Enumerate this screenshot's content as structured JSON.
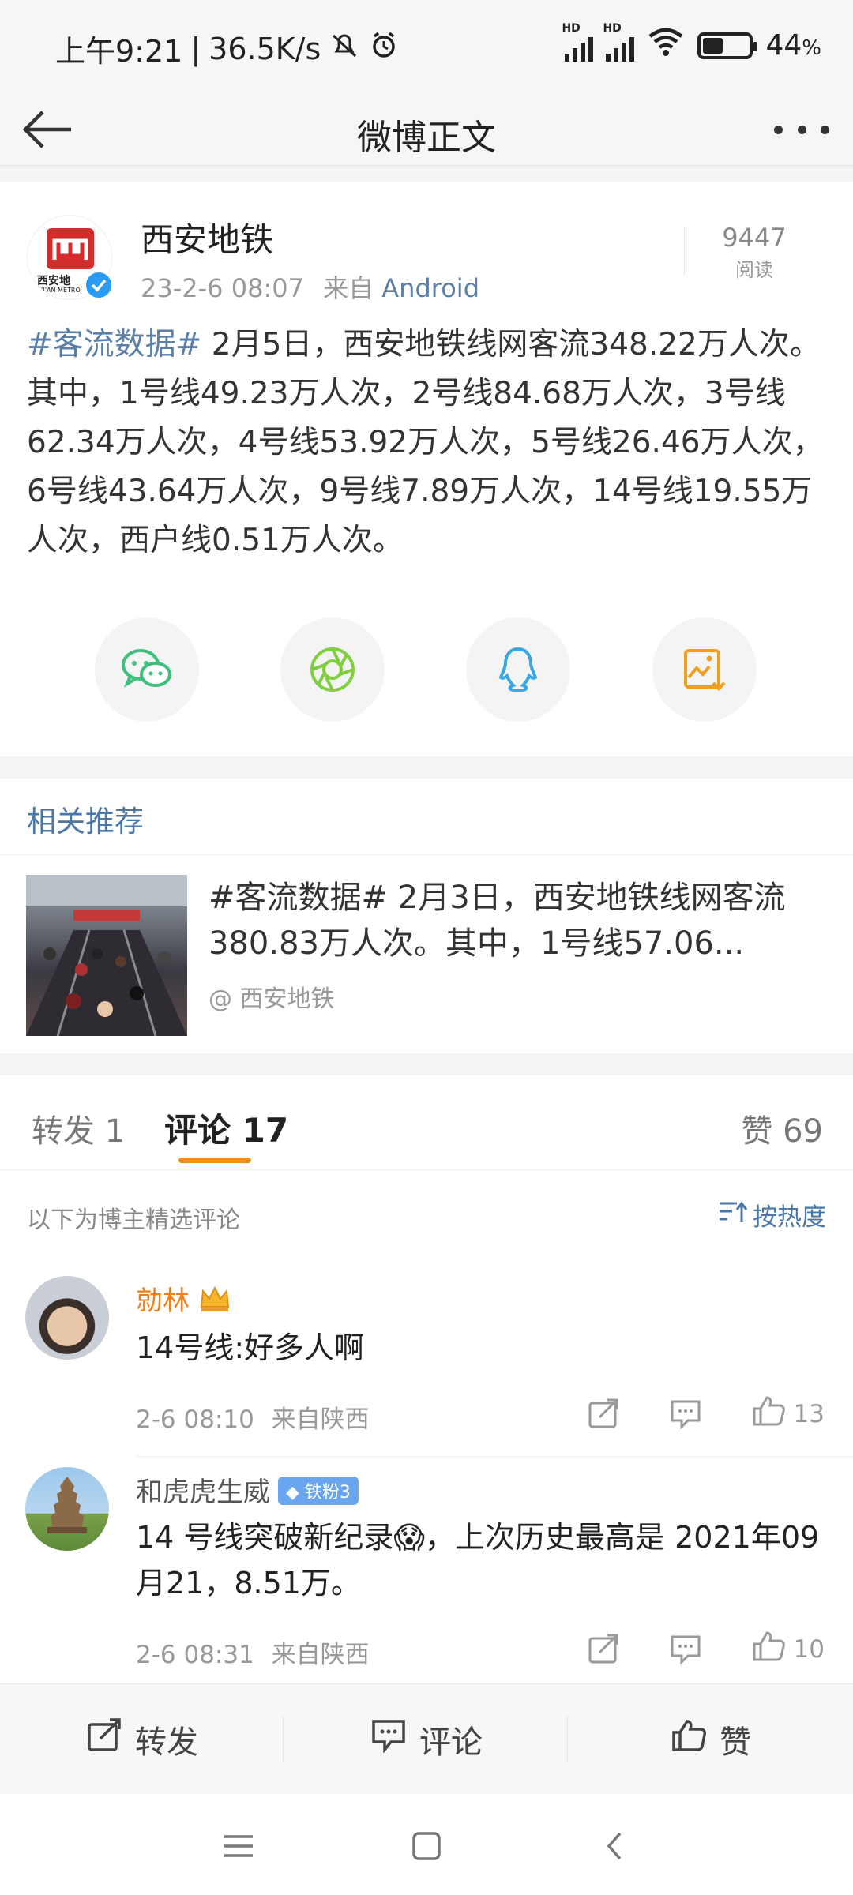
{
  "status_bar": {
    "time": "上午9:21",
    "net_speed": "36.5K/s",
    "battery": "44",
    "battery_unit": "%",
    "battery_level": 0.44,
    "signal_label_1": "HD",
    "signal_label_2": "HD",
    "icons": [
      "mute-bell-icon",
      "alarm-icon",
      "signal-icon",
      "signal-icon",
      "wifi-icon",
      "battery-icon"
    ]
  },
  "nav": {
    "title": "微博正文",
    "back_icon": "back-arrow-icon",
    "more_icon": "more-icon"
  },
  "post": {
    "author": "西安地铁",
    "logo_text": "西安地",
    "logo_sub": "XI'AN METRO",
    "time": "23-2-6 08:07",
    "source_prefix": "来自",
    "source": "Android",
    "read_count": "9447",
    "read_label": "阅读",
    "tag": "#客流数据#",
    "text": " 2月5日，西安地铁线网客流348.22万人次。其中，1号线49.23万人次，2号线84.68万人次，3号线62.34万人次，4号线53.92万人次，5号线26.46万人次，6号线43.64万人次，9号线7.89万人次，14号线19.55万人次，西户线0.51万人次。",
    "share": [
      "wechat-icon",
      "moments-icon",
      "qq-icon",
      "save-image-icon"
    ]
  },
  "recommend": {
    "title": "相关推荐",
    "item_text": "#客流数据# 2月3日，西安地铁线网客流380.83万人次。其中，1号线57.06...",
    "item_author": "@ 西安地铁"
  },
  "tabs": {
    "repost": "转发 1",
    "comment": "评论 17",
    "like": "赞 69"
  },
  "comments_header": {
    "hint": "以下为博主精选评论",
    "sort": "按热度"
  },
  "comments": [
    {
      "name": "勍林",
      "body": "14号线:好多人啊",
      "time": "2-6 08:10",
      "location": "来自陕西",
      "likes": "13"
    },
    {
      "name": "和虎虎生威",
      "badge": "铁粉3",
      "body": "14 号线突破新纪录😱，上次历史最高是 2021年09月21，8.51万。",
      "time": "2-6 08:31",
      "location": "来自陕西",
      "likes": "10"
    }
  ],
  "bottom_bar": {
    "repost": "转发",
    "comment": "评论",
    "like": "赞"
  },
  "colors": {
    "link": "#5b7fa6",
    "accent_orange": "#f28c1e",
    "wechat_green": "#3ec07c",
    "moments_green": "#7fcf3e",
    "qq_blue": "#3aa6e6",
    "save_orange": "#f0a020"
  }
}
